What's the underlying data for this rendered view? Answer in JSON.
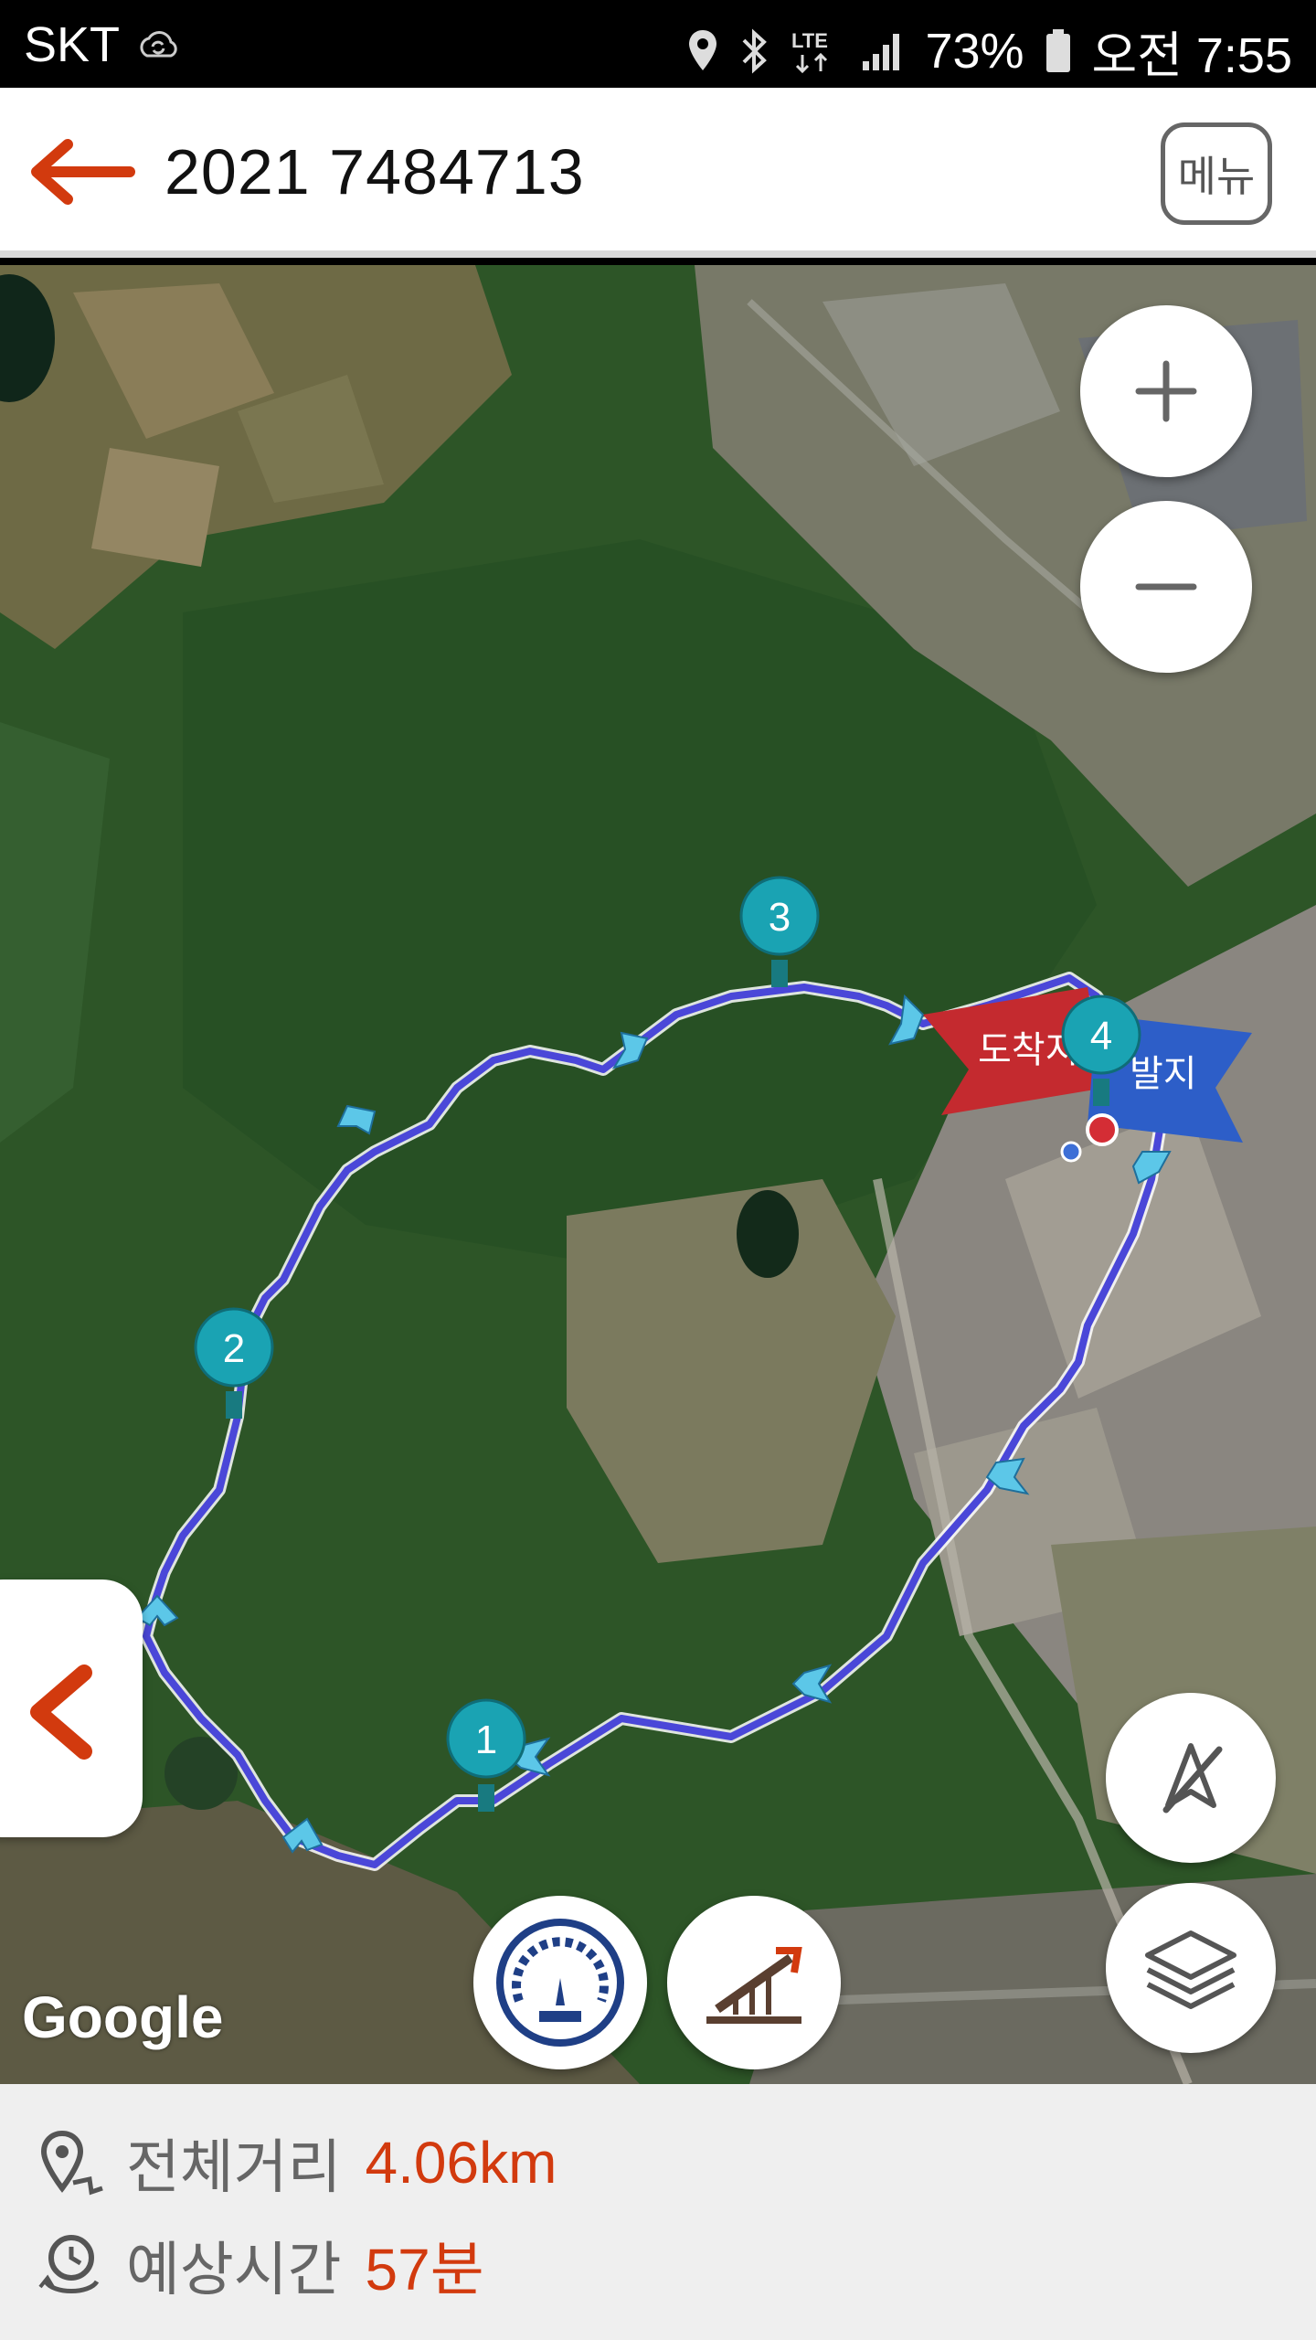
{
  "status_bar": {
    "carrier": "SKT",
    "network": "LTE",
    "battery": "73%",
    "time": "오전 7:55",
    "icons": [
      "cloud-sync-icon",
      "location-icon",
      "bluetooth-icon",
      "lte-icon",
      "signal-icon",
      "battery-icon"
    ]
  },
  "header": {
    "title": "2021 7484713",
    "menu_label": "메뉴",
    "back_icon": "back-arrow-icon"
  },
  "map": {
    "markers": [
      {
        "label": "1"
      },
      {
        "label": "2"
      },
      {
        "label": "3"
      },
      {
        "label": "4"
      }
    ],
    "arrival_flag": "도착지",
    "departure_flag": "출발지",
    "arrival_flag_visible": "도착지",
    "departure_flag_visible": "발지",
    "provider": "Google",
    "route_color": "#4a47d8",
    "marker_color": "#1aa3b3",
    "buttons": [
      "zoom-in-icon",
      "zoom-out-icon",
      "compass-off-icon",
      "layers-icon",
      "speedometer-icon",
      "elevation-icon",
      "collapse-left-icon"
    ]
  },
  "info": {
    "distance_label": "전체거리",
    "distance_value": "4.06km",
    "time_label": "예상시간",
    "time_value": "57분",
    "accent_color": "#d23a0e"
  }
}
